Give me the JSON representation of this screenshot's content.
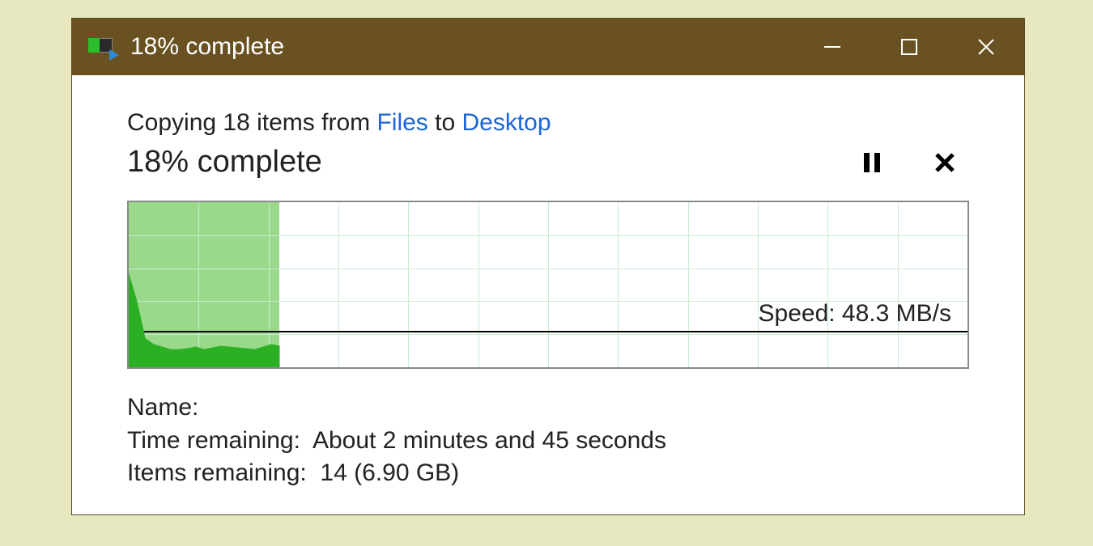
{
  "window": {
    "title": "18% complete"
  },
  "copy": {
    "prefix": "Copying 18 items from ",
    "source": "Files",
    "mid": " to ",
    "dest": "Desktop"
  },
  "progress": {
    "percent_label": "18% complete",
    "percent_value": 18
  },
  "speed": {
    "label": "Speed: 48.3 MB/s",
    "line_pct_from_top": 78
  },
  "details": {
    "name_label": "Name:",
    "name_value": "",
    "time_label": "Time remaining:  ",
    "time_value": "About 2 minutes and 45 seconds",
    "items_label": "Items remaining:  ",
    "items_value": "14 (6.90 GB)"
  },
  "chart_data": {
    "type": "area",
    "x": [
      0,
      1,
      2,
      3,
      4,
      5,
      6,
      7,
      8,
      9,
      10,
      11,
      12,
      13,
      14,
      15,
      16,
      17,
      18
    ],
    "values": [
      115,
      80,
      35,
      28,
      25,
      22,
      22,
      23,
      25,
      22,
      24,
      26,
      25,
      24,
      23,
      22,
      25,
      28,
      26
    ],
    "ylabel": "MB/s",
    "ylim": [
      0,
      200
    ],
    "xlim_pct": [
      0,
      18
    ],
    "current_speed": 48.3,
    "progress_fill_pct": 18
  }
}
